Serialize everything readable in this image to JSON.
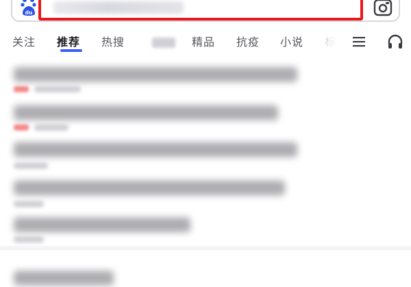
{
  "search": {
    "placeholder": "",
    "highlight_color": "#e8191c"
  },
  "icons": {
    "logo": "baidu-paw-logo",
    "camera": "camera-icon",
    "menu": "menu-icon",
    "headphones": "headphones-icon"
  },
  "tabs": [
    {
      "label": "关注",
      "active": false
    },
    {
      "label": "推荐",
      "active": true
    },
    {
      "label": "热搜",
      "active": false
    },
    {
      "label": "",
      "active": false
    },
    {
      "label": "精品",
      "active": false
    },
    {
      "label": "抗疫",
      "active": false
    },
    {
      "label": "小说",
      "active": false
    },
    {
      "label": "标",
      "active": false
    }
  ],
  "colors": {
    "active_tab_indicator": "#3d5bf5",
    "tab_text": "#55555c",
    "tab_active_text": "#1a1a1f"
  }
}
